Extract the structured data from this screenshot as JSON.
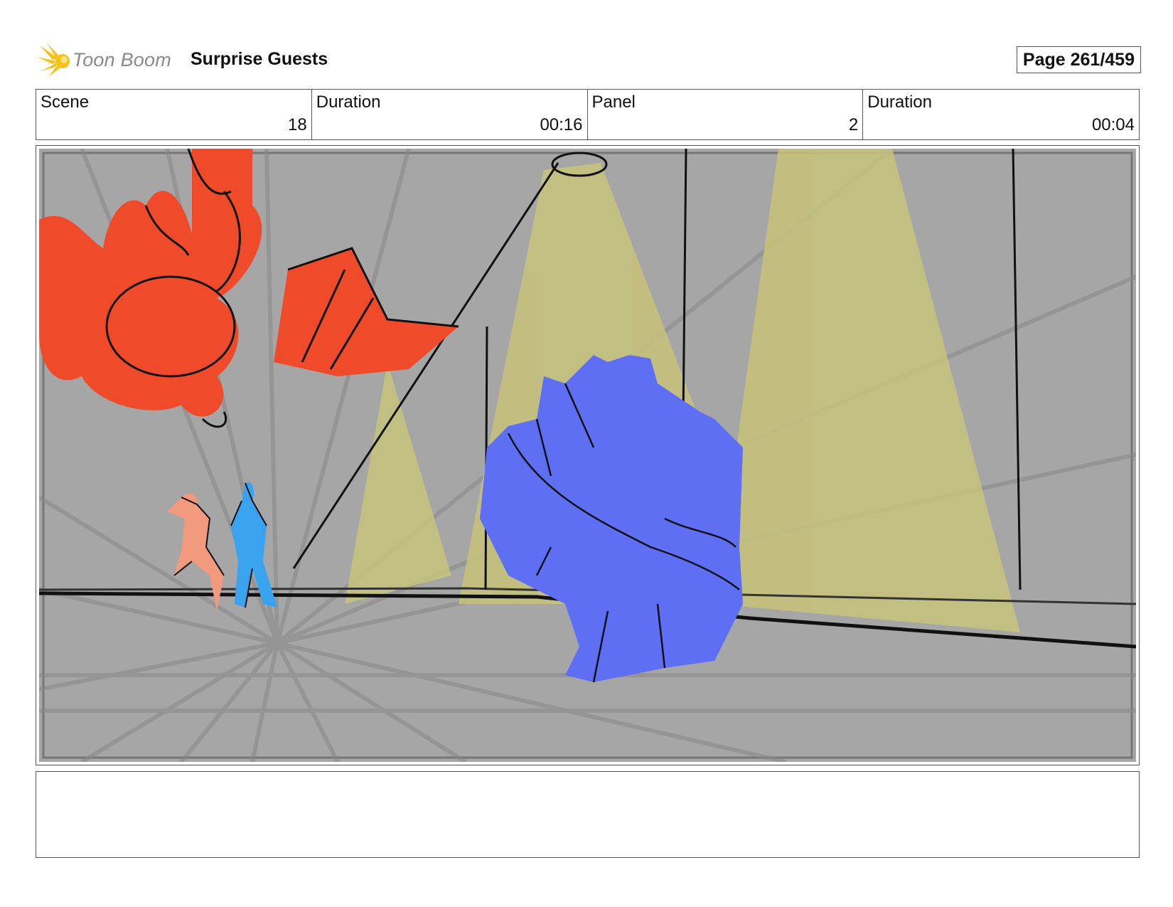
{
  "brand": {
    "logo_text": "Toon Boom",
    "logo_icon": "starburst-icon"
  },
  "project": {
    "title": "Surprise Guests"
  },
  "page": {
    "label": "Page 261/459"
  },
  "info": {
    "scene_label": "Scene",
    "scene_value": "18",
    "scene_duration_label": "Duration",
    "scene_duration_value": "00:16",
    "panel_label": "Panel",
    "panel_value": "2",
    "panel_duration_label": "Duration",
    "panel_duration_value": "00:04"
  },
  "colors": {
    "background_gray": "#a6a6a6",
    "spotlight_yellow": "#c6c37a",
    "red_creature": "#ef4b2b",
    "blue_figure_small": "#3aa3f0",
    "blue_figure_large": "#5f6ff4",
    "pink_figure": "#f29a7e"
  },
  "notes": {
    "text": ""
  }
}
